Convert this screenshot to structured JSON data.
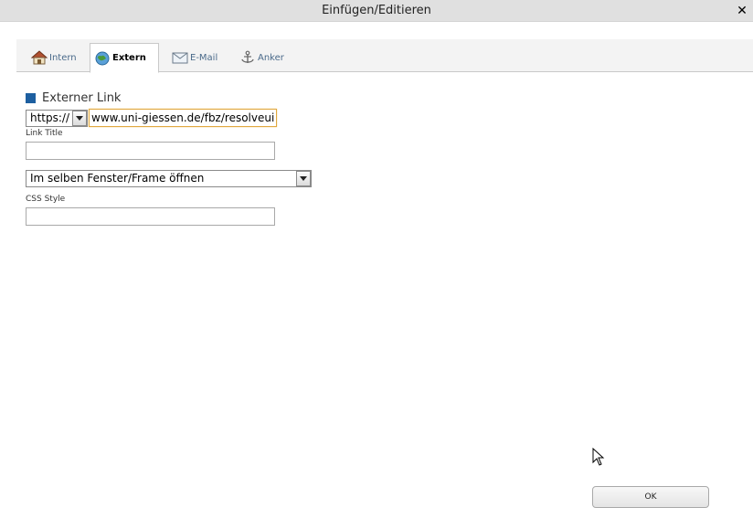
{
  "dialog": {
    "title": "Einfügen/Editieren",
    "close_symbol": "✕"
  },
  "tabs": [
    {
      "label": "Intern",
      "icon": "house-icon",
      "active": false
    },
    {
      "label": "Extern",
      "icon": "globe-icon",
      "active": true
    },
    {
      "label": "E-Mail",
      "icon": "envelope-icon",
      "active": false
    },
    {
      "label": "Anker",
      "icon": "anchor-icon",
      "active": false
    }
  ],
  "form": {
    "section_title": "Externer Link",
    "protocol": {
      "selected": "https://"
    },
    "url_value": "www.uni-giessen.de/fbz/resolveuid/",
    "link_title_label": "Link Title",
    "link_title_value": "",
    "target": {
      "selected": "Im selben Fenster/Frame öffnen"
    },
    "css_style_label": "CSS Style",
    "css_style_value": ""
  },
  "footer": {
    "ok_label": "OK"
  },
  "colors": {
    "accent": "#1d5fa0",
    "titlebar_bg": "#e0e0e0",
    "focus_border": "#e0a840"
  }
}
